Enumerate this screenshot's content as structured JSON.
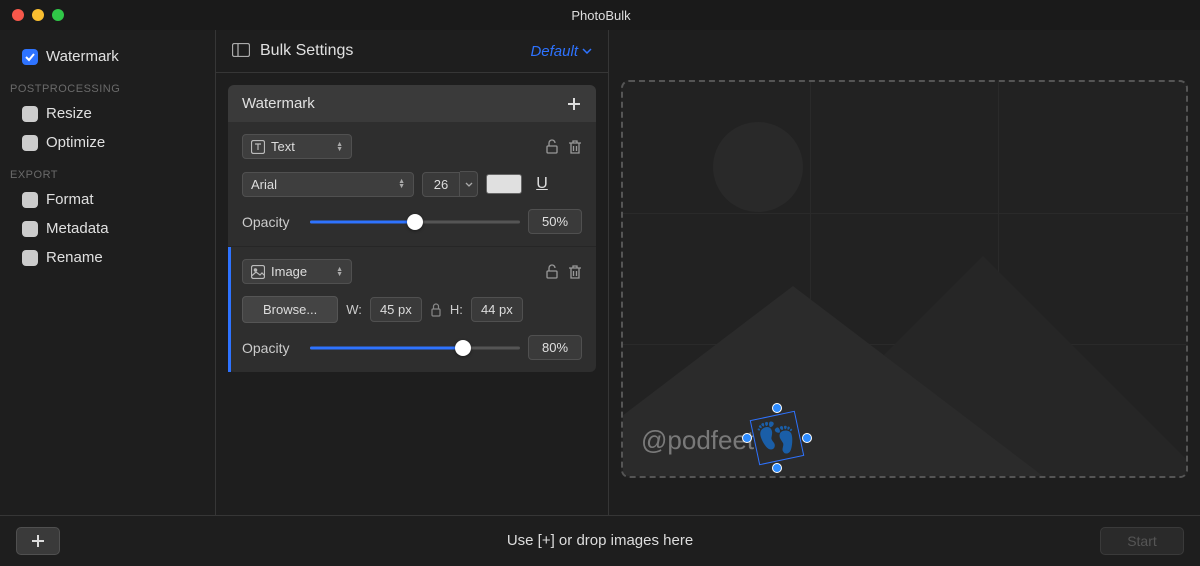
{
  "app": {
    "title": "PhotoBulk"
  },
  "sidebar": {
    "items": [
      {
        "label": "Watermark",
        "checked": true
      }
    ],
    "sections": [
      {
        "title": "POSTPROCESSING",
        "items": [
          {
            "label": "Resize",
            "checked": false
          },
          {
            "label": "Optimize",
            "checked": false
          }
        ]
      },
      {
        "title": "EXPORT",
        "items": [
          {
            "label": "Format",
            "checked": false
          },
          {
            "label": "Metadata",
            "checked": false
          },
          {
            "label": "Rename",
            "checked": false
          }
        ]
      }
    ]
  },
  "settings": {
    "title": "Bulk Settings",
    "preset": "Default",
    "group": {
      "title": "Watermark"
    },
    "text_wm": {
      "type": "Text",
      "font": "Arial",
      "size": "26",
      "color": "#E0E0E0",
      "opacity_label": "Opacity",
      "opacity_value": "50%",
      "opacity_pct": 50
    },
    "image_wm": {
      "type": "Image",
      "browse": "Browse...",
      "w_label": "W:",
      "w_value": "45 px",
      "h_label": "H:",
      "h_value": "44 px",
      "opacity_label": "Opacity",
      "opacity_value": "80%",
      "opacity_pct": 73
    }
  },
  "preview": {
    "wm_text": "@podfeet",
    "wm_emoji": "👣"
  },
  "footer": {
    "hint": "Use [+] or drop images here",
    "start": "Start"
  }
}
